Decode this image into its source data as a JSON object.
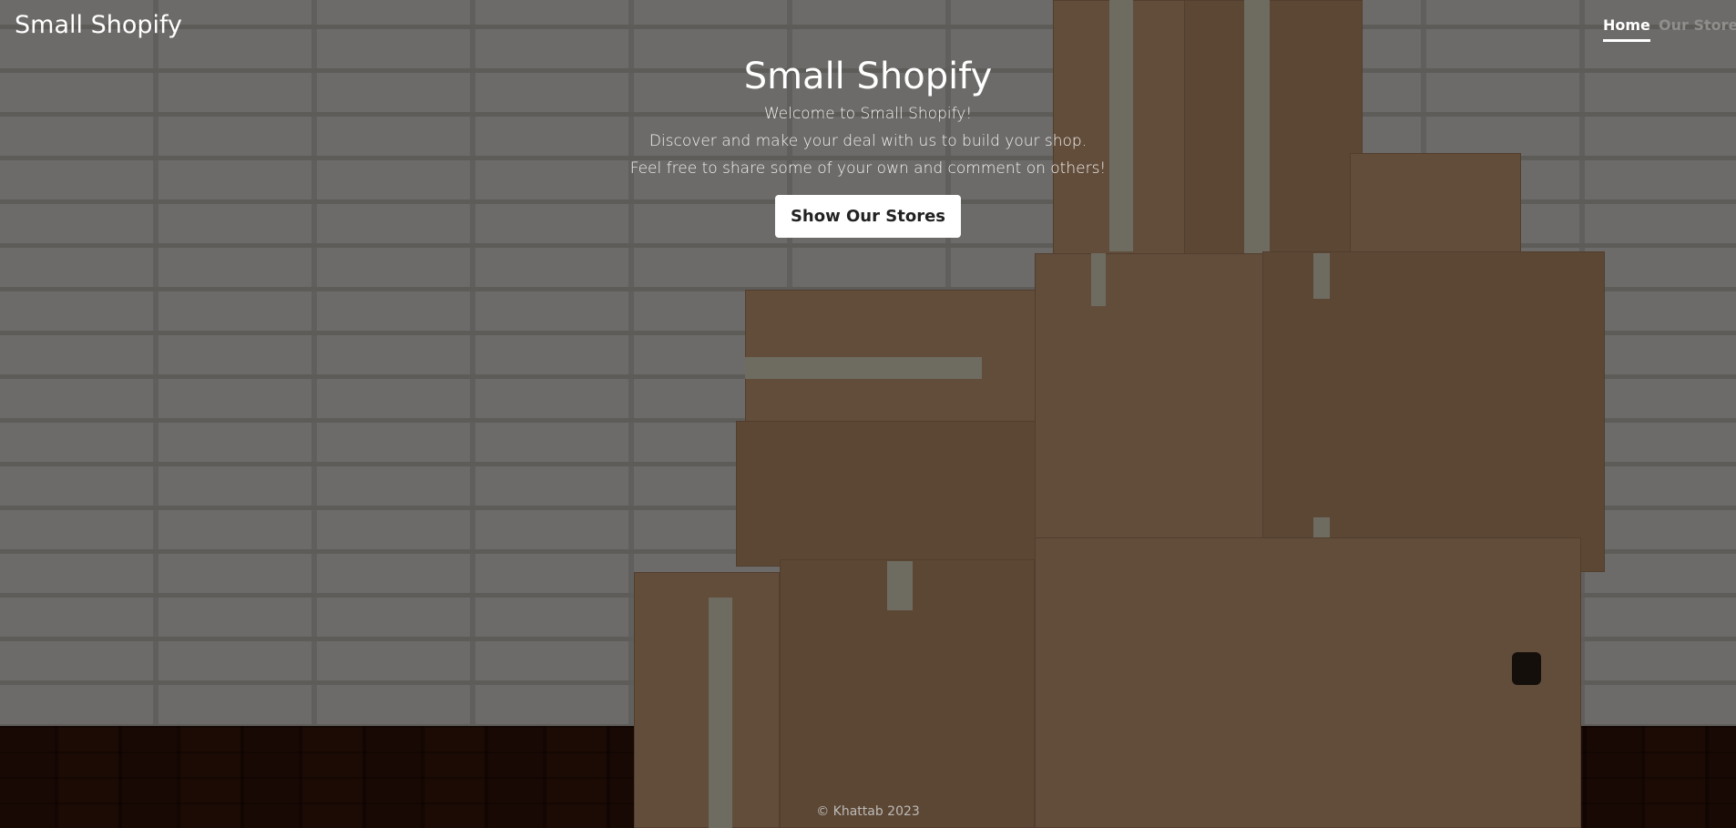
{
  "brand": {
    "name": "Small Shopify"
  },
  "nav": {
    "items": [
      {
        "label": "Home",
        "active": true
      },
      {
        "label": "Our Stores",
        "active": false
      }
    ]
  },
  "hero": {
    "title": "Small Shopify",
    "lines": [
      "Welcome to Small Shopify!",
      "Discover and make your deal with us to build your shop.",
      "Feel free to share some of your own and comment on others!"
    ],
    "cta_label": "Show Our Stores"
  },
  "footer": {
    "text": "© Khattab 2023"
  },
  "colors": {
    "overlay": "rgba(0,0,0,0.5)",
    "cta_background": "#ffffff",
    "text_primary": "#ffffff",
    "nav_inactive": "#8f8e8c"
  }
}
